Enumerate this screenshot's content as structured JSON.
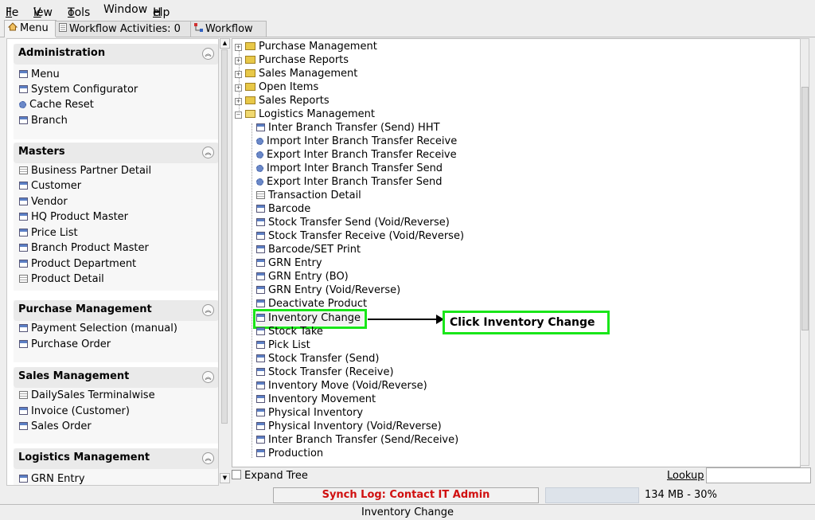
{
  "menubar": [
    {
      "label": "File",
      "mn": "F",
      "rest": "ile"
    },
    {
      "label": "View",
      "mn": "V",
      "rest": "iew"
    },
    {
      "label": "Tools",
      "mn": "T",
      "rest": "ools"
    },
    {
      "label": "Window",
      "mn": "",
      "rest": "Window"
    },
    {
      "label": "Help",
      "mn": "H",
      "rest": "elp"
    }
  ],
  "tabs": {
    "menu": "Menu",
    "workflow_activities": "Workflow Activities: 0",
    "workflow": "Workflow"
  },
  "left_sections": [
    {
      "title": "Administration",
      "items": [
        {
          "label": "Menu",
          "icon": "window-icon"
        },
        {
          "label": "System Configurator",
          "icon": "window-icon"
        },
        {
          "label": "Cache Reset",
          "icon": "process-icon"
        },
        {
          "label": "Branch",
          "icon": "window-icon"
        }
      ]
    },
    {
      "title": "Masters",
      "items": [
        {
          "label": "Business Partner Detail",
          "icon": "report-icon"
        },
        {
          "label": "Customer",
          "icon": "window-icon"
        },
        {
          "label": "Vendor",
          "icon": "window-icon"
        },
        {
          "label": "HQ Product Master",
          "icon": "window-icon"
        },
        {
          "label": "Price List",
          "icon": "window-icon"
        },
        {
          "label": "Branch Product Master",
          "icon": "window-icon"
        },
        {
          "label": "Product Department",
          "icon": "window-icon"
        },
        {
          "label": "Product Detail",
          "icon": "report-icon"
        }
      ]
    },
    {
      "title": "Purchase Management",
      "items": [
        {
          "label": "Payment Selection (manual)",
          "icon": "window-icon"
        },
        {
          "label": "Purchase Order",
          "icon": "window-icon"
        }
      ]
    },
    {
      "title": "Sales Management",
      "items": [
        {
          "label": "DailySales Terminalwise",
          "icon": "report-icon"
        },
        {
          "label": "Invoice (Customer)",
          "icon": "window-icon"
        },
        {
          "label": "Sales Order",
          "icon": "window-icon"
        }
      ]
    },
    {
      "title": "Logistics Management",
      "items": [
        {
          "label": "GRN Entry",
          "icon": "window-icon"
        }
      ]
    }
  ],
  "tree": {
    "folders": [
      {
        "label": "Purchase Management"
      },
      {
        "label": "Purchase Reports"
      },
      {
        "label": "Sales Management"
      },
      {
        "label": "Open Items"
      },
      {
        "label": "Sales Reports"
      },
      {
        "label": "Logistics Management"
      }
    ],
    "children": [
      {
        "label": "Inter Branch Transfer (Send) HHT",
        "icon": "window-icon"
      },
      {
        "label": "Import Inter Branch Transfer Receive",
        "icon": "process-icon"
      },
      {
        "label": "Export Inter Branch Transfer Receive",
        "icon": "process-icon"
      },
      {
        "label": "Import Inter Branch Transfer Send",
        "icon": "process-icon"
      },
      {
        "label": "Export Inter Branch Transfer Send",
        "icon": "process-icon"
      },
      {
        "label": "Transaction Detail",
        "icon": "report-icon"
      },
      {
        "label": "Barcode",
        "icon": "window-icon"
      },
      {
        "label": "Stock Transfer Send (Void/Reverse)",
        "icon": "window-icon"
      },
      {
        "label": "Stock Transfer Receive (Void/Reverse)",
        "icon": "window-icon"
      },
      {
        "label": "Barcode/SET Print",
        "icon": "window-icon"
      },
      {
        "label": "GRN Entry",
        "icon": "window-icon"
      },
      {
        "label": "GRN Entry (BO)",
        "icon": "window-icon"
      },
      {
        "label": "GRN Entry (Void/Reverse)",
        "icon": "window-icon"
      },
      {
        "label": "Deactivate Product",
        "icon": "window-icon"
      },
      {
        "label": "Inventory Change",
        "icon": "window-icon"
      },
      {
        "label": "Stock Take",
        "icon": "window-icon"
      },
      {
        "label": "Pick List",
        "icon": "window-icon"
      },
      {
        "label": "Stock Transfer (Send)",
        "icon": "window-icon"
      },
      {
        "label": "Stock Transfer (Receive)",
        "icon": "window-icon"
      },
      {
        "label": "Inventory Move (Void/Reverse)",
        "icon": "window-icon"
      },
      {
        "label": "Inventory Movement",
        "icon": "window-icon"
      },
      {
        "label": "Physical Inventory",
        "icon": "window-icon"
      },
      {
        "label": "Physical Inventory (Void/Reverse)",
        "icon": "window-icon"
      },
      {
        "label": "Inter Branch Transfer (Send/Receive)",
        "icon": "window-icon"
      },
      {
        "label": "Production",
        "icon": "window-icon"
      }
    ],
    "selected": "Inventory Change"
  },
  "callout": "Click Inventory Change",
  "expand_tree_label": "Expand Tree",
  "lookup_label": "Lookup",
  "synch_log": "Synch Log: Contact IT Admin",
  "memory": "134 MB - 30%",
  "statusbar": "Inventory Change",
  "colors": {
    "highlight": "#19e619",
    "synch_text": "#d01010"
  }
}
